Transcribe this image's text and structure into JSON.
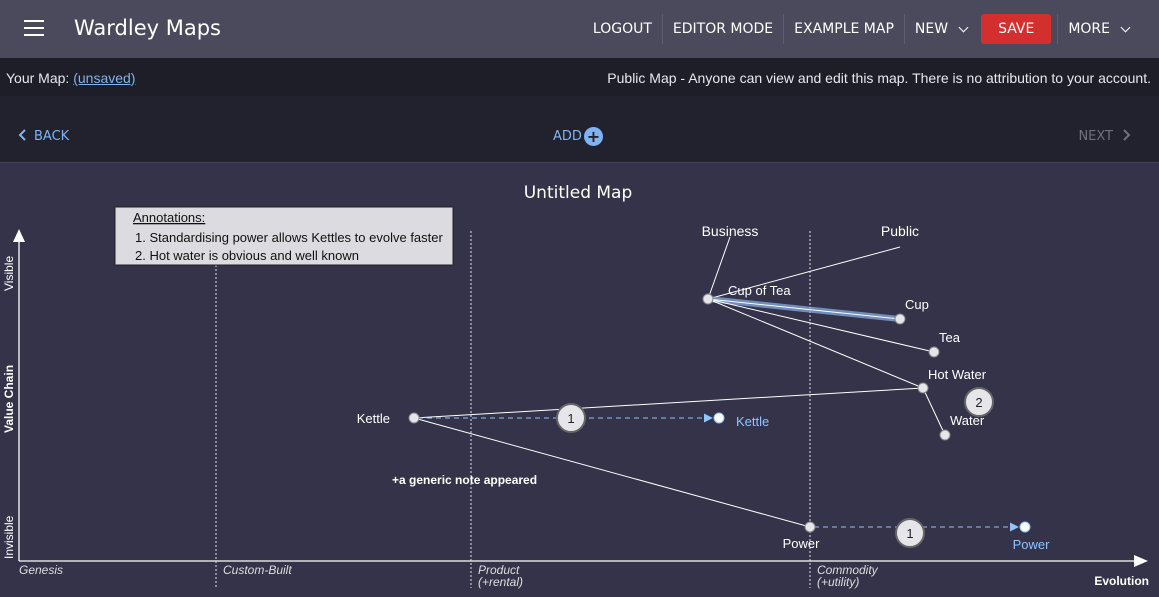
{
  "appbar": {
    "title": "Wardley Maps",
    "menu": {
      "logout": "LOGOUT",
      "editor_mode": "EDITOR MODE",
      "example_map": "EXAMPLE MAP",
      "new": "NEW",
      "save": "SAVE",
      "more": "MORE"
    }
  },
  "infobar": {
    "your_map_label": "Your Map:",
    "map_status": "(unsaved)",
    "public_notice": "Public Map - Anyone can view and edit this map. There is no attribution to your account."
  },
  "stepper": {
    "back": "BACK",
    "add": "ADD",
    "add_symbol": "+",
    "next": "NEXT"
  },
  "map": {
    "title": "Untitled Map",
    "annotations_box": {
      "heading": "Annotations:",
      "items": [
        "1. Standardising power allows Kettles to evolve faster",
        "2. Hot water is obvious and well known"
      ]
    },
    "axes": {
      "y_label": "Value Chain",
      "y_top": "Visible",
      "y_bottom": "Invisible",
      "x_label": "Evolution",
      "stages": [
        {
          "line1": "Genesis",
          "line2": ""
        },
        {
          "line1": "Custom-Built",
          "line2": ""
        },
        {
          "line1": "Product",
          "line2": "(+rental)"
        },
        {
          "line1": "Commodity",
          "line2": "(+utility)"
        }
      ]
    },
    "anchors": [
      "Business",
      "Public"
    ],
    "components": [
      "Cup of Tea",
      "Cup",
      "Tea",
      "Hot Water",
      "Water",
      "Kettle",
      "Power"
    ],
    "evolved": [
      "Kettle",
      "Power"
    ],
    "annotation_markers": [
      "1",
      "1",
      "2"
    ],
    "note": "+a generic note appeared",
    "colors": {
      "background": "#34334a",
      "evolved": "#8ec5ff",
      "save": "#d32f2f",
      "link": "#7fb4f0"
    }
  }
}
